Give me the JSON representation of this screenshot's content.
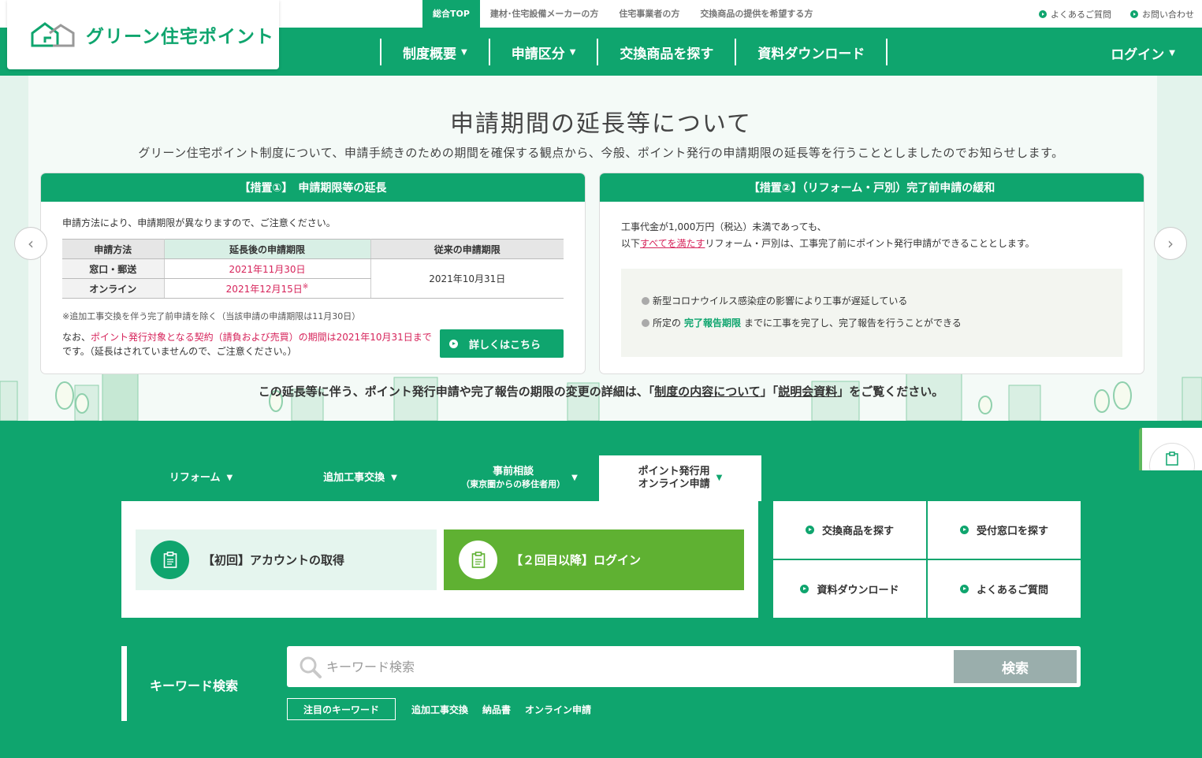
{
  "site": {
    "logo_text": "グリーン住宅ポイント"
  },
  "top_nav": [
    {
      "label": "総合TOP",
      "active": true
    },
    {
      "label": "建材･住宅設備メーカーの方"
    },
    {
      "label": "住宅事業者の方"
    },
    {
      "label": "交換商品の提供を希望する方"
    }
  ],
  "top_links": [
    {
      "label": "よくあるご質問"
    },
    {
      "label": "お問い合わせ"
    }
  ],
  "main_nav": [
    {
      "label": "制度概要",
      "caret": "▼"
    },
    {
      "label": "申請区分",
      "caret": "▼"
    },
    {
      "label": "交換商品を探す"
    },
    {
      "label": "資料ダウンロード"
    }
  ],
  "login": {
    "label": "ログイン",
    "caret": "▼"
  },
  "hero": {
    "title": "申請期間の延長等について",
    "lead": "グリーン住宅ポイント制度について、申請手続きのための期間を確保する観点から、今般、ポイント発行の申請期限の延長等を行うこととしましたのでお知らせします。",
    "card1": {
      "heading": "【措置①】　申請期限等の延長",
      "note": "申請方法により、申請期限が異なりますので、ご注意ください。",
      "table": {
        "headers": [
          "申請方法",
          "延長後の申請期限",
          "従来の申請期限"
        ],
        "rows": [
          {
            "method": "窓口・郵送",
            "new_deadline": "2021年11月30日",
            "mark": ""
          },
          {
            "method": "オンライン",
            "new_deadline": "2021年12月15日",
            "mark": "※"
          }
        ],
        "old_deadline": "2021年10月31日"
      },
      "footnote": "※追加工事交換を伴う完了前申請を除く（当該申請の申請期限は11月30日）",
      "warn_prefix": "なお、",
      "warn_red": "ポイント発行対象となる契約（請負および売買）の期間は2021年10月31日まで",
      "warn_suffix": "です。（延長はされていませんので、ご注意ください。）",
      "detail_button": "詳しくはこちら"
    },
    "card2": {
      "heading": "【措置②】（リフォーム・戸別）完了前申請の緩和",
      "line1": "工事代金が1,000万円（税込）未満であっても、",
      "line2_prefix": "以下",
      "line2_link": "すべてを満たす",
      "line2_suffix": "リフォーム・戸別は、工事完了前にポイント発行申請ができることとします。",
      "bullet1": "新型コロナウイルス感染症の影響により工事が遅延している",
      "bullet2_prefix": "所定の",
      "bullet2_green": "完了報告期限",
      "bullet2_suffix": "までに工事を完了し、完了報告を行うことができる"
    },
    "footer_prefix": "この延長等に伴う、ポイント発行申請や完了報告の期限の変更の詳細は、「",
    "footer_link1": "制度の内容について",
    "footer_mid": "」「",
    "footer_link2": "説明会資料",
    "footer_suffix": "」をご覧ください。",
    "prev_arrow": "‹",
    "next_arrow": "›"
  },
  "tabs": [
    {
      "label": "リフォーム",
      "caret": "▼"
    },
    {
      "label": "追加工事交換",
      "caret": "▼"
    },
    {
      "label_line1": "事前相談",
      "label_line2": "（東京圏からの移住者用）",
      "caret": "▼"
    },
    {
      "label_line1": "ポイント発行用",
      "label_line2": "オンライン申請",
      "caret": "▼",
      "active": true
    }
  ],
  "panel": {
    "account_button": "【初回】アカウントの取得",
    "login_button": "【２回目以降】ログイン"
  },
  "quick_links": [
    {
      "label": "交換商品を探す"
    },
    {
      "label": "受付窓口を探す"
    },
    {
      "label": "資料ダウンロード"
    },
    {
      "label": "よくあるご質問"
    }
  ],
  "search": {
    "label": "キーワード検索",
    "placeholder": "キーワード検索",
    "button": "検索",
    "hot_label": "注目のキーワード",
    "keywords": [
      "追加工事交換",
      "納品書",
      "オンライン申請"
    ]
  },
  "colors": {
    "brand_green": "#0fa56e",
    "accent_red": "#d6235a",
    "login_green": "#5fb132"
  }
}
